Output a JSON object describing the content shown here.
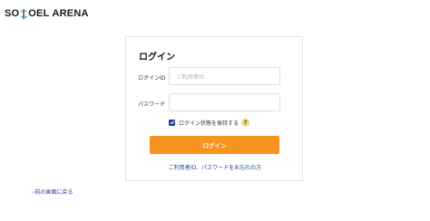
{
  "brand": {
    "logo_text_1": "SO",
    "logo_text_2": "OEL",
    "logo_text_3": "ARENA",
    "logo_accent": "#1e90d6"
  },
  "login": {
    "title": "ログイン",
    "id_label": "ログインID",
    "id_placeholder": "ご利用者ID",
    "password_label": "パスワード",
    "remember_label": "ログイン状態を保持する",
    "remember_checked": true,
    "help_icon": "?",
    "submit_label": "ログイン",
    "forgot_link": "ご利用者ID、パスワードをお忘れの方"
  },
  "navigation": {
    "back_link": "前の画面に戻る"
  },
  "colors": {
    "primary_button": "#f7931e",
    "link": "#1f3f8f",
    "checkbox": "#1e3a8a"
  }
}
